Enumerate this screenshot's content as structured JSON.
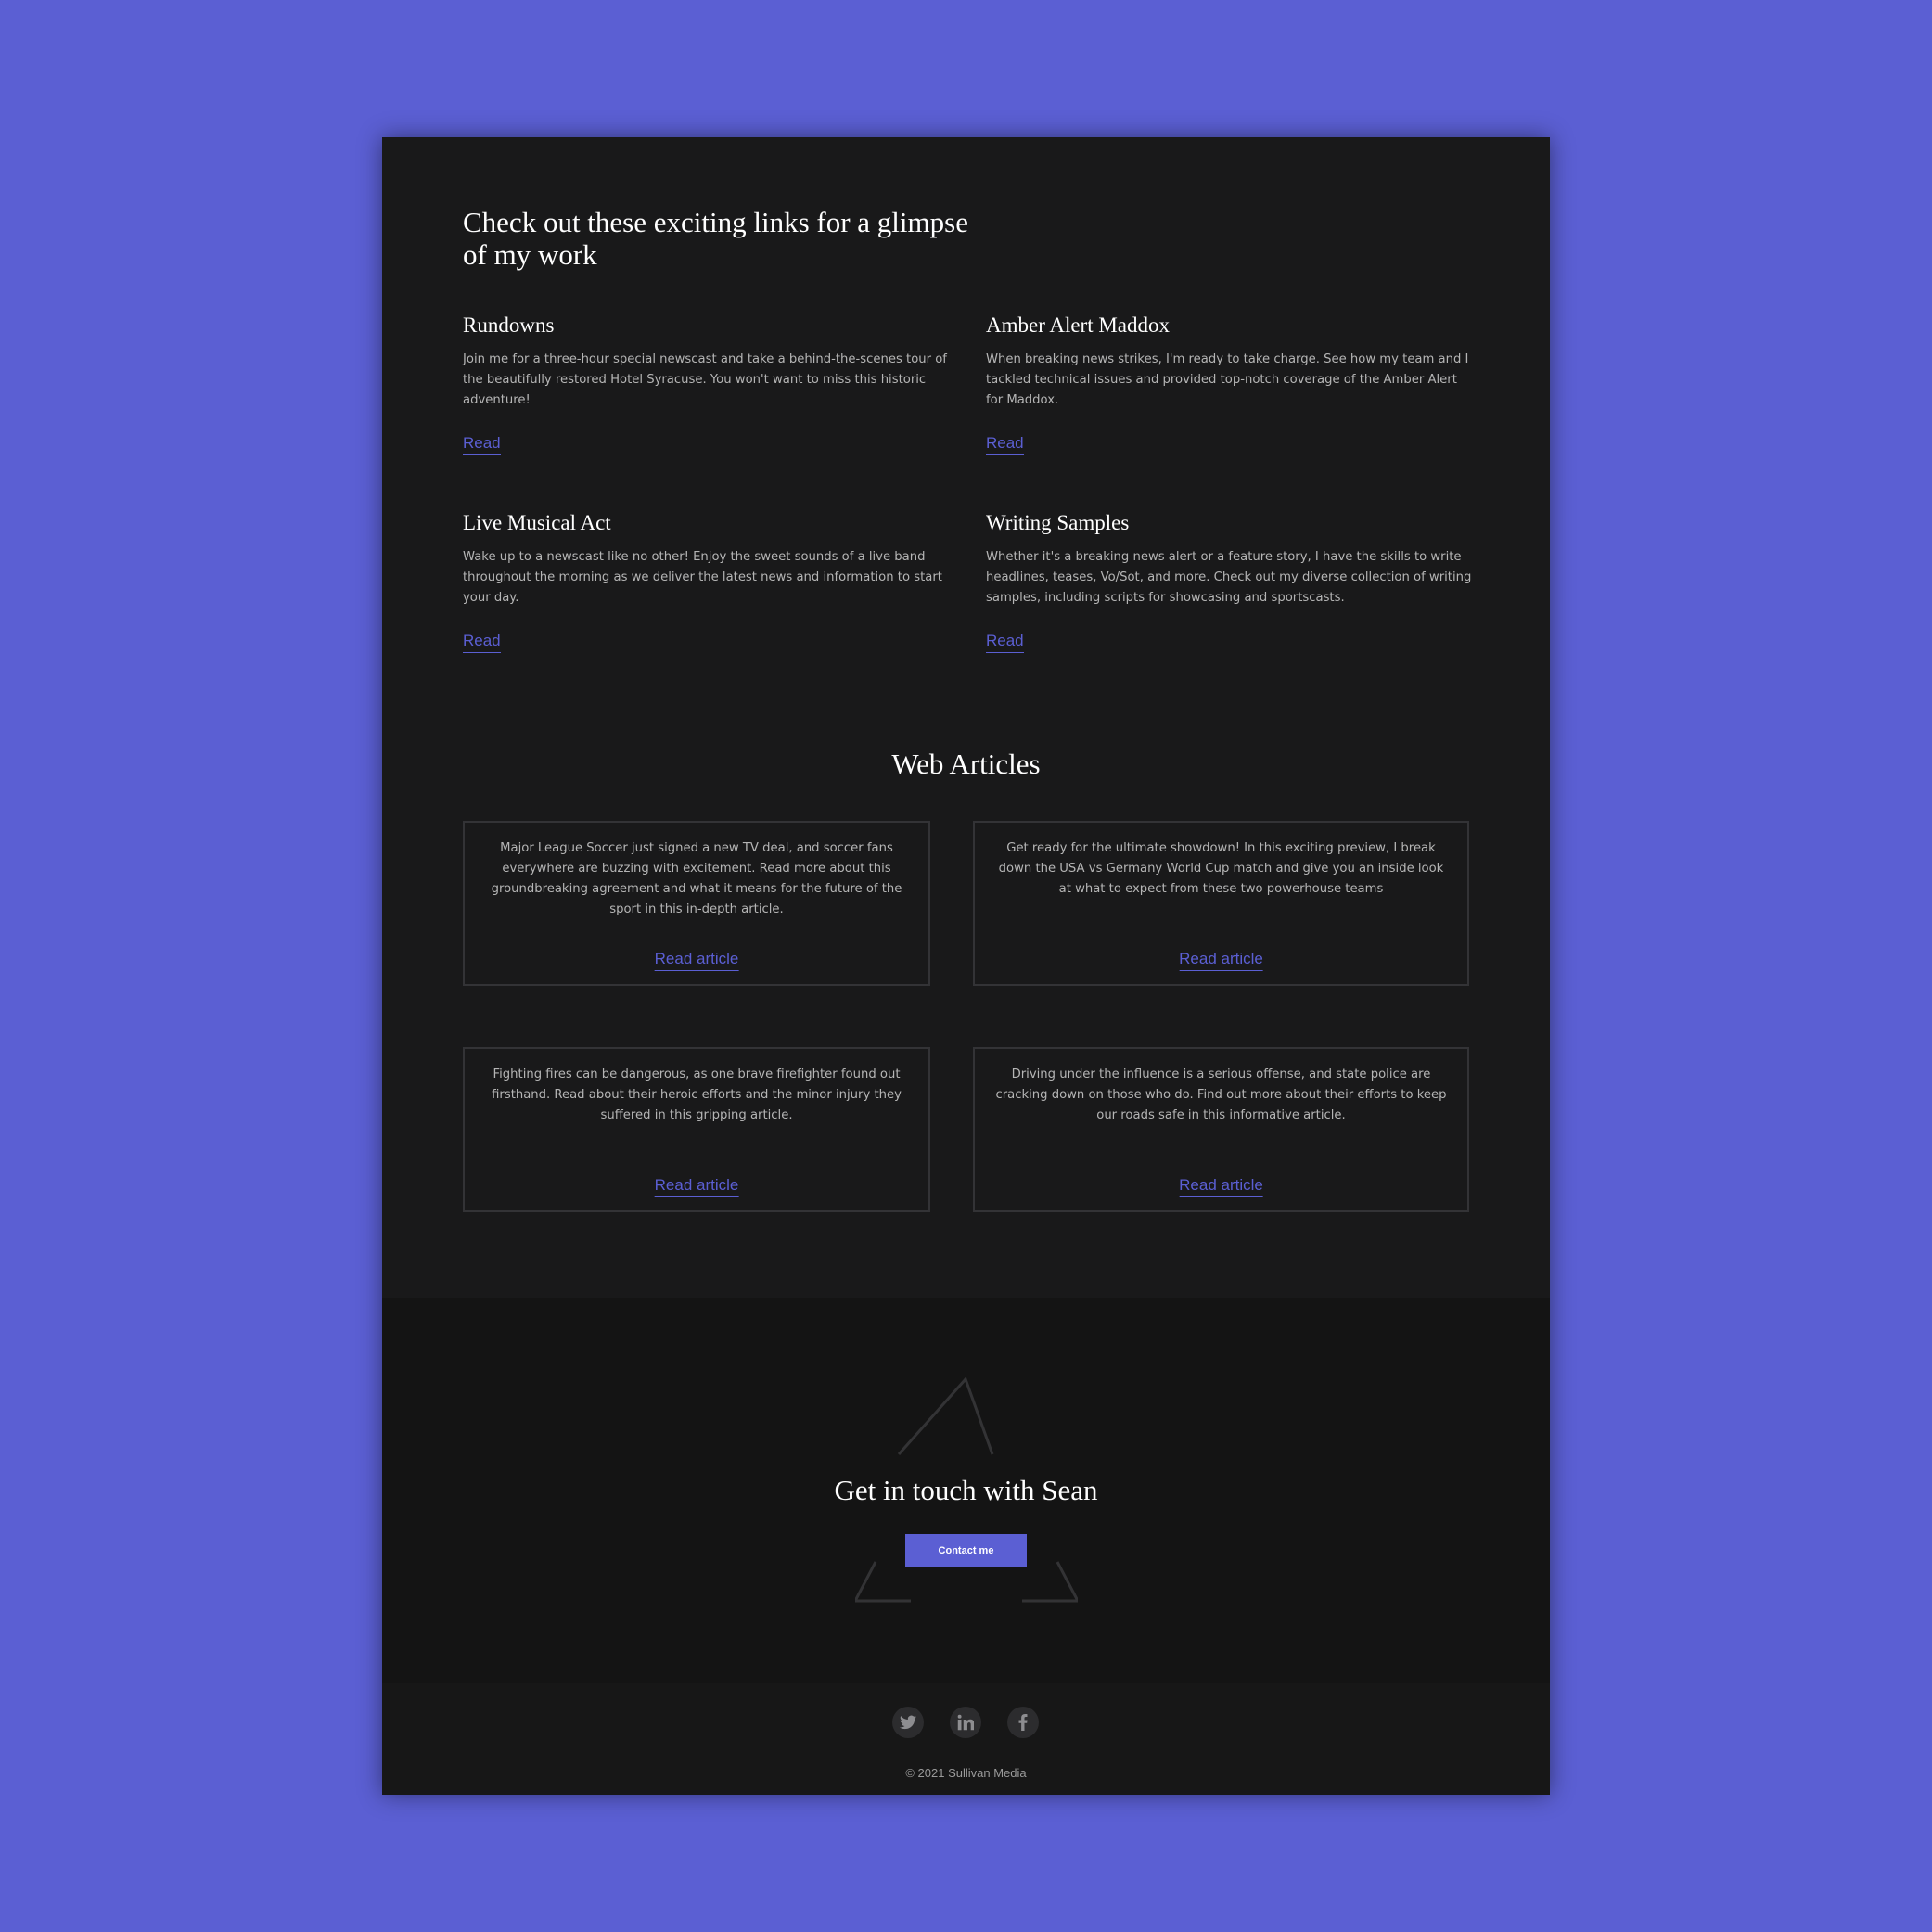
{
  "intro": {
    "title": "Check out these exciting links for a glimpse of my work"
  },
  "links": [
    {
      "title": "Rundowns",
      "description": "Join me for a three-hour special newscast and take a behind-the-scenes tour of the beautifully restored Hotel Syracuse. You won't want to miss this historic adventure!",
      "link_label": "Read"
    },
    {
      "title": "Amber Alert Maddox",
      "description": "When breaking news strikes, I'm ready to take charge. See how my team and I tackled technical issues and provided top-notch coverage of the Amber Alert for Maddox.",
      "link_label": "Read"
    },
    {
      "title": "Live Musical Act",
      "description": "Wake up to a newscast like no other! Enjoy the sweet sounds of a live band throughout the morning as we deliver the latest news and information to start your day.",
      "link_label": "Read"
    },
    {
      "title": "Writing Samples",
      "description": "Whether it's a breaking news alert or a feature story, I have the skills to write headlines, teases, Vo/Sot, and more. Check out my diverse collection of writing samples, including scripts for showcasing and sportscasts.",
      "link_label": "Read"
    }
  ],
  "web_articles": {
    "title": "Web Articles",
    "articles": [
      {
        "description": "Major League Soccer just signed a new TV deal, and soccer fans everywhere are buzzing with excitement. Read more about this groundbreaking agreement and what it means for the future of the sport in this in-depth article.",
        "link_label": "Read article"
      },
      {
        "description": "Get ready for the ultimate showdown! In this exciting preview, I break down the USA vs Germany World Cup match and give you an inside look at what to expect from these two powerhouse teams",
        "link_label": "Read article"
      },
      {
        "description": "Fighting fires can be dangerous, as one brave firefighter found out firsthand. Read about their heroic efforts and the minor injury they suffered in this gripping article.",
        "link_label": "Read article"
      },
      {
        "description": "Driving under the influence is a serious offense, and state police are cracking down on those who do. Find out more about their efforts to keep our roads safe in this informative article.",
        "link_label": "Read article"
      }
    ]
  },
  "contact": {
    "title": "Get in touch with Sean",
    "button_label": "Contact me"
  },
  "footer": {
    "social_icons": [
      "twitter-icon",
      "linkedin-icon",
      "facebook-icon"
    ],
    "copyright": "© 2021 Sullivan Media"
  },
  "colors": {
    "background": "#5b5fd3",
    "accent": "#5b5fd3",
    "page": "#19191a",
    "contact_section": "#141414",
    "footer": "#171717"
  }
}
